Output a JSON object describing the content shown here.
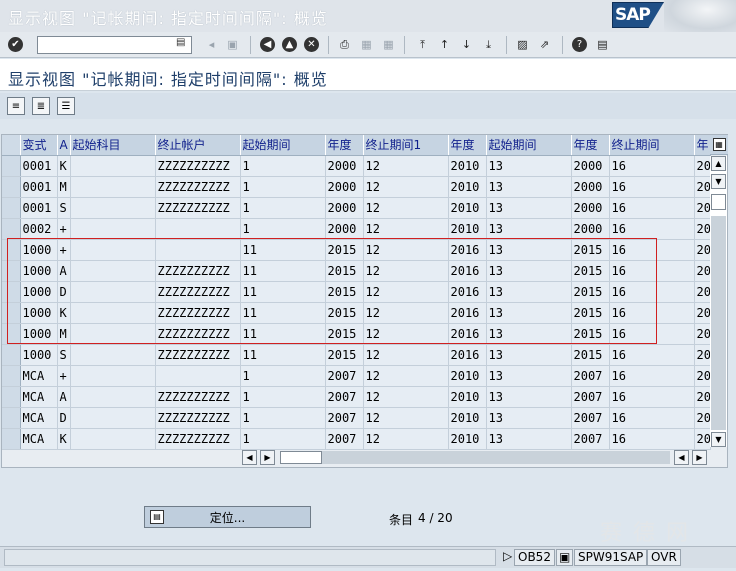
{
  "window": {
    "title": "显示视图 \"记帐期间: 指定时间间隔\": 概览",
    "logo": "SAP"
  },
  "screen": {
    "title": "显示视图 \"记帐期间: 指定时间间隔\": 概览"
  },
  "command_field": {
    "value": "",
    "placeholder": ""
  },
  "table": {
    "columns": [
      "变式",
      "A",
      "起始科目",
      "终止帐户",
      "起始期间",
      "年度",
      "终止期间1",
      "年度",
      "起始期间",
      "年度",
      "终止期间",
      "年"
    ],
    "rows": [
      [
        "0001",
        "K",
        "",
        "ZZZZZZZZZZ",
        "1",
        "2000",
        "12",
        "2010",
        "13",
        "2000",
        "16",
        "20"
      ],
      [
        "0001",
        "M",
        "",
        "ZZZZZZZZZZ",
        "1",
        "2000",
        "12",
        "2010",
        "13",
        "2000",
        "16",
        "20"
      ],
      [
        "0001",
        "S",
        "",
        "ZZZZZZZZZZ",
        "1",
        "2000",
        "12",
        "2010",
        "13",
        "2000",
        "16",
        "20"
      ],
      [
        "0002",
        "+",
        "",
        "",
        "1",
        "2000",
        "12",
        "2010",
        "13",
        "2000",
        "16",
        "20"
      ],
      [
        "1000",
        "+",
        "",
        "",
        "11",
        "2015",
        "12",
        "2016",
        "13",
        "2015",
        "16",
        "20"
      ],
      [
        "1000",
        "A",
        "",
        "ZZZZZZZZZZ",
        "11",
        "2015",
        "12",
        "2016",
        "13",
        "2015",
        "16",
        "20"
      ],
      [
        "1000",
        "D",
        "",
        "ZZZZZZZZZZ",
        "11",
        "2015",
        "12",
        "2016",
        "13",
        "2015",
        "16",
        "20"
      ],
      [
        "1000",
        "K",
        "",
        "ZZZZZZZZZZ",
        "11",
        "2015",
        "12",
        "2016",
        "13",
        "2015",
        "16",
        "20"
      ],
      [
        "1000",
        "M",
        "",
        "ZZZZZZZZZZ",
        "11",
        "2015",
        "12",
        "2016",
        "13",
        "2015",
        "16",
        "20"
      ],
      [
        "1000",
        "S",
        "",
        "ZZZZZZZZZZ",
        "11",
        "2015",
        "12",
        "2016",
        "13",
        "2015",
        "16",
        "20"
      ],
      [
        "MCA",
        "+",
        "",
        "",
        "1",
        "2007",
        "12",
        "2010",
        "13",
        "2007",
        "16",
        "20"
      ],
      [
        "MCA",
        "A",
        "",
        "ZZZZZZZZZZ",
        "1",
        "2007",
        "12",
        "2010",
        "13",
        "2007",
        "16",
        "20"
      ],
      [
        "MCA",
        "D",
        "",
        "ZZZZZZZZZZ",
        "1",
        "2007",
        "12",
        "2010",
        "13",
        "2007",
        "16",
        "20"
      ],
      [
        "MCA",
        "K",
        "",
        "ZZZZZZZZZZ",
        "1",
        "2007",
        "12",
        "2010",
        "13",
        "2007",
        "16",
        "20"
      ]
    ]
  },
  "locate_button": {
    "label": "定位..."
  },
  "entry": {
    "label": "条目",
    "value": "4 / 20"
  },
  "statusbar": {
    "transaction": "OB52",
    "system": "SPW91SAP",
    "mode": "OVR"
  },
  "watermark": "赛 德 网",
  "colors": {
    "header_bg": "#c6d4e2",
    "header_text": "#0f1f8c",
    "cell_bg": "#e6edf4",
    "highlight": "#d02020",
    "title_text": "#1f3f6a"
  }
}
